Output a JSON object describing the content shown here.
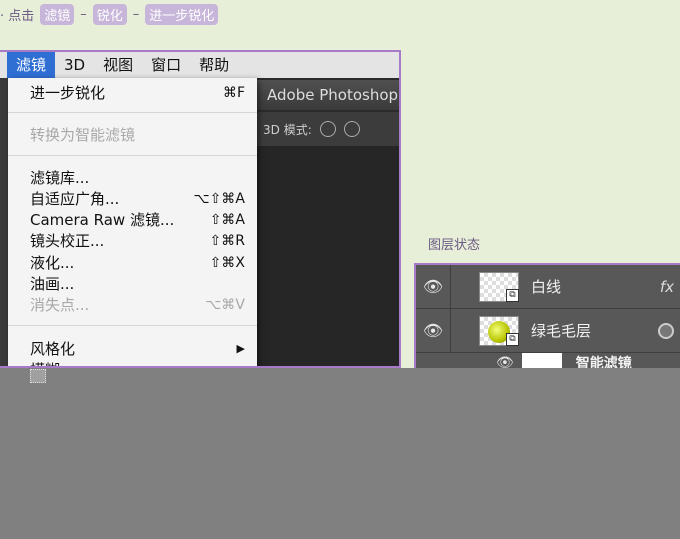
{
  "breadcrumb": {
    "prefix": "· 点击",
    "steps": [
      "滤镜",
      "锐化",
      "进一步锐化"
    ],
    "separator": "–"
  },
  "menubar": {
    "items": [
      "滤镜",
      "3D",
      "视图",
      "窗口",
      "帮助"
    ],
    "active_index": 0
  },
  "app": {
    "title": "Adobe Photoshop C",
    "options_label": "3D 模式:"
  },
  "filter_menu": {
    "items": [
      {
        "label": "进一步锐化",
        "shortcut": "⌘F",
        "enabled": true
      },
      {
        "label": "转换为智能滤镜",
        "shortcut": "",
        "enabled": false
      },
      {
        "label": "滤镜库...",
        "shortcut": "",
        "enabled": true
      },
      {
        "label": "自适应广角...",
        "shortcut": "⌥⇧⌘A",
        "enabled": true
      },
      {
        "label": "Camera Raw 滤镜...",
        "shortcut": "⇧⌘A",
        "enabled": true
      },
      {
        "label": "镜头校正...",
        "shortcut": "⇧⌘R",
        "enabled": true
      },
      {
        "label": "液化...",
        "shortcut": "⇧⌘X",
        "enabled": true
      },
      {
        "label": "油画...",
        "shortcut": "",
        "enabled": true
      },
      {
        "label": "消失点...",
        "shortcut": "⌥⌘V",
        "enabled": false
      },
      {
        "label": "风格化",
        "shortcut": "▶",
        "enabled": true
      },
      {
        "label": "模糊",
        "shortcut": "▶",
        "enabled": true
      }
    ]
  },
  "layers": {
    "caption": "图层状态",
    "rows": [
      {
        "name": "白线",
        "badge": "fx",
        "eye": "visible"
      },
      {
        "name": "绿毛毛层",
        "badge": "",
        "eye": "visible"
      }
    ],
    "sub_row": {
      "label": "智能滤镜"
    }
  },
  "icons": {
    "eye": "eye-icon",
    "smart_object": "smart-object-icon",
    "link": "link-icon",
    "cursor": "cursor-icon"
  },
  "colors": {
    "page_bg": "#e8efd8",
    "accent_purple": "#a77bc9",
    "tag_bg": "#c7b6d9",
    "menu_highlight": "#2f6fd4"
  }
}
